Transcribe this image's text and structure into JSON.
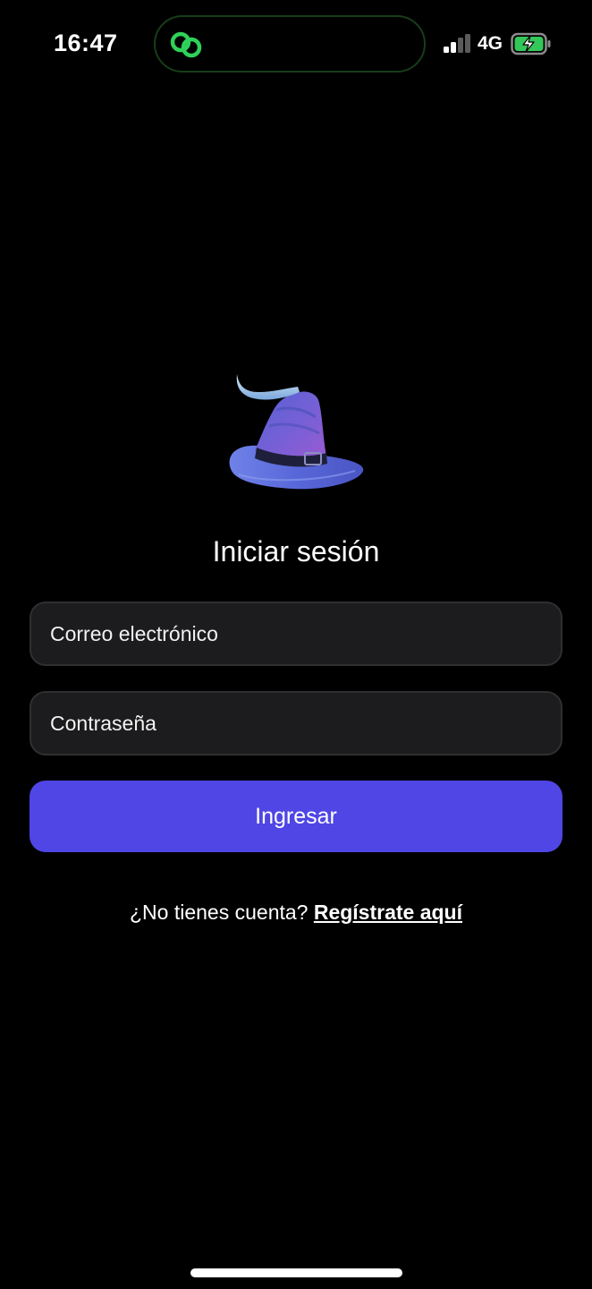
{
  "status_bar": {
    "time": "16:47",
    "network": "4G",
    "island_icon": "linked-circles-icon",
    "signal_icon": "signal-bars-icon",
    "battery_icon": "battery-charging-icon",
    "island_accent": "#2fd158",
    "battery_color": "#34c759"
  },
  "logo": {
    "icon": "wizard-hat-icon"
  },
  "login": {
    "title": "Iniciar sesión",
    "email_placeholder": "Correo electrónico",
    "password_placeholder": "Contraseña",
    "submit_label": "Ingresar",
    "register_prompt": "¿No tienes cuenta?",
    "register_link": "Regístrate aquí"
  },
  "colors": {
    "background": "#000000",
    "field_bg": "#1c1c1e",
    "primary": "#4f46e5"
  }
}
